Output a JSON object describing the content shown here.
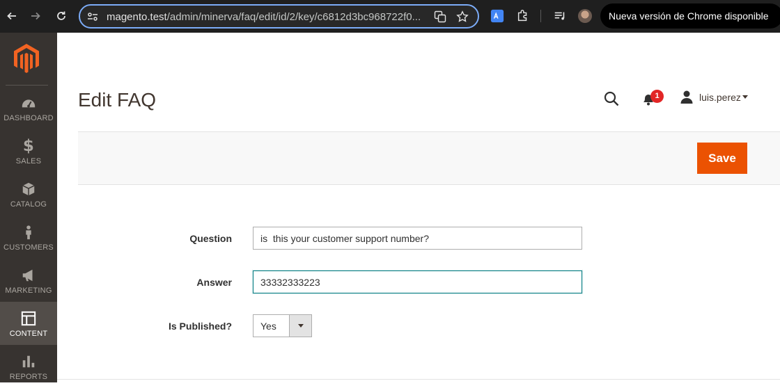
{
  "browser": {
    "url_host": "magento.test",
    "url_path": "/admin/minerva/faq/edit/id/2/key/c6812d3bc968722f0...",
    "update_label": "Nueva versión de Chrome disponible"
  },
  "sidebar": {
    "items": [
      {
        "label": "Dashboard",
        "icon": "dashboard-icon"
      },
      {
        "label": "Sales",
        "icon": "dollar-icon"
      },
      {
        "label": "Catalog",
        "icon": "box-icon"
      },
      {
        "label": "Customers",
        "icon": "person-icon"
      },
      {
        "label": "Marketing",
        "icon": "megaphone-icon"
      },
      {
        "label": "Content",
        "icon": "layout-icon",
        "active": true
      },
      {
        "label": "Reports",
        "icon": "bar-chart-icon"
      }
    ]
  },
  "header": {
    "title": "Edit FAQ",
    "notification_count": "1",
    "username": "luis.perez"
  },
  "actions": {
    "save_label": "Save"
  },
  "form": {
    "question_label": "Question",
    "question_value": "is  this your customer support number?",
    "answer_label": "Answer",
    "answer_value": "33332333223",
    "published_label": "Is Published?",
    "published_value": "Yes"
  },
  "colors": {
    "accent": "#eb5202",
    "sidebar_bg": "#373330",
    "focus": "#007b80",
    "badge": "#e22626"
  }
}
